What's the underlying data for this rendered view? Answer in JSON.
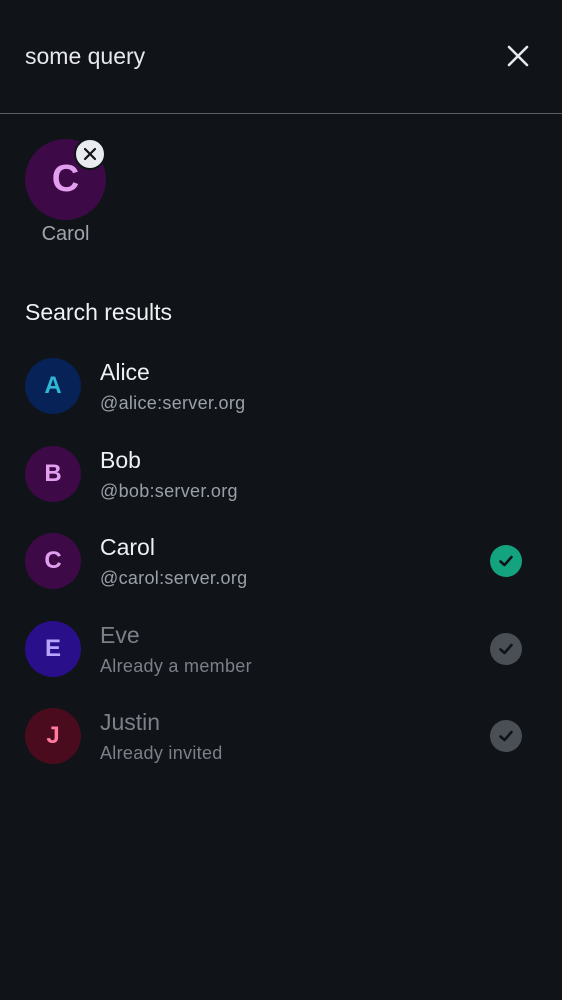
{
  "search": {
    "query": "some query",
    "close_icon": "close-icon"
  },
  "selected": [
    {
      "initial": "C",
      "name": "Carol",
      "avatar_bg": "#3d0a47",
      "avatar_fg": "#e29ff0",
      "remove_icon": "close-small-icon"
    }
  ],
  "section_title": "Search results",
  "results": [
    {
      "initial": "A",
      "name": "Alice",
      "subtitle": "@alice:server.org",
      "avatar_bg": "#062257",
      "avatar_fg": "#2eb8d6",
      "state": "none"
    },
    {
      "initial": "B",
      "name": "Bob",
      "subtitle": "@bob:server.org",
      "avatar_bg": "#3d0a47",
      "avatar_fg": "#e29ff0",
      "state": "none"
    },
    {
      "initial": "C",
      "name": "Carol",
      "subtitle": "@carol:server.org",
      "avatar_bg": "#3d0a47",
      "avatar_fg": "#e29ff0",
      "state": "selected",
      "check_color": "#14a37f"
    },
    {
      "initial": "E",
      "name": "Eve",
      "subtitle": "Already a member",
      "avatar_bg": "#2a0f8a",
      "avatar_fg": "#b7a4ff",
      "state": "disabled",
      "check_color": "#4a4e55"
    },
    {
      "initial": "J",
      "name": "Justin",
      "subtitle": "Already invited",
      "avatar_bg": "#4a0b1e",
      "avatar_fg": "#ff7a9c",
      "state": "disabled",
      "check_color": "#4a4e55"
    }
  ]
}
